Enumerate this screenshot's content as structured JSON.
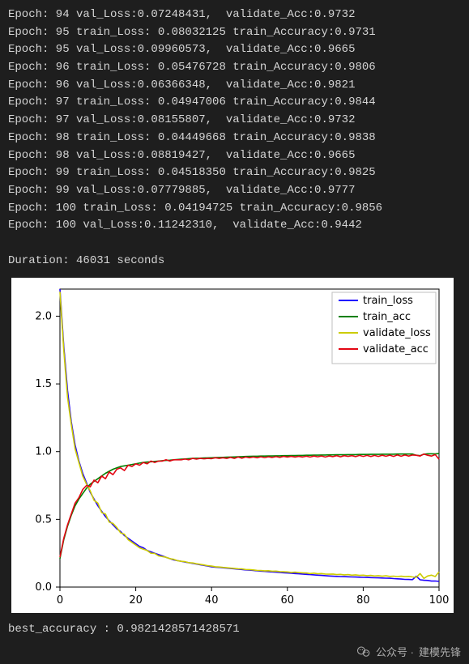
{
  "console_lines": [
    "Epoch: 94 val_Loss:0.07248431,  validate_Acc:0.9732",
    "Epoch: 95 train_Loss: 0.08032125 train_Accuracy:0.9731",
    "Epoch: 95 val_Loss:0.09960573,  validate_Acc:0.9665",
    "Epoch: 96 train_Loss: 0.05476728 train_Accuracy:0.9806",
    "Epoch: 96 val_Loss:0.06366348,  validate_Acc:0.9821",
    "Epoch: 97 train_Loss: 0.04947006 train_Accuracy:0.9844",
    "Epoch: 97 val_Loss:0.08155807,  validate_Acc:0.9732",
    "Epoch: 98 train_Loss: 0.04449668 train_Accuracy:0.9838",
    "Epoch: 98 val_Loss:0.08819427,  validate_Acc:0.9665",
    "Epoch: 99 train_Loss: 0.04518350 train_Accuracy:0.9825",
    "Epoch: 99 val_Loss:0.07779885,  validate_Acc:0.9777",
    "Epoch: 100 train_Loss: 0.04194725 train_Accuracy:0.9856",
    "Epoch: 100 val_Loss:0.11242310,  validate_Acc:0.9442",
    "",
    "Duration: 46031 seconds"
  ],
  "bottom_line": "best_accuracy : 0.9821428571428571",
  "watermark": {
    "prefix": "公众号 · ",
    "name": "建模先锋"
  },
  "chart_data": {
    "type": "line",
    "xlim": [
      0,
      100
    ],
    "ylim": [
      0.0,
      2.2
    ],
    "xticks": [
      0,
      20,
      40,
      60,
      80,
      100
    ],
    "yticks": [
      0.0,
      0.5,
      1.0,
      1.5,
      2.0
    ],
    "legend": [
      "train_loss",
      "train_acc",
      "validate_loss",
      "validate_acc"
    ],
    "legend_colors": {
      "train_loss": "#1f00ff",
      "train_acc": "#008000",
      "validate_loss": "#cccc00",
      "validate_acc": "#e30613"
    },
    "x": [
      0,
      1,
      2,
      3,
      4,
      5,
      6,
      7,
      8,
      9,
      10,
      11,
      12,
      13,
      14,
      15,
      16,
      17,
      18,
      19,
      20,
      21,
      22,
      23,
      24,
      25,
      26,
      27,
      28,
      29,
      30,
      31,
      32,
      33,
      34,
      35,
      36,
      37,
      38,
      39,
      40,
      41,
      42,
      43,
      44,
      45,
      46,
      47,
      48,
      49,
      50,
      51,
      52,
      53,
      54,
      55,
      56,
      57,
      58,
      59,
      60,
      61,
      62,
      63,
      64,
      65,
      66,
      67,
      68,
      69,
      70,
      71,
      72,
      73,
      74,
      75,
      76,
      77,
      78,
      79,
      80,
      81,
      82,
      83,
      84,
      85,
      86,
      87,
      88,
      89,
      90,
      91,
      92,
      93,
      94,
      95,
      96,
      97,
      98,
      99,
      100
    ],
    "series": [
      {
        "name": "train_loss",
        "color": "#1f00ff",
        "values": [
          2.2,
          1.78,
          1.45,
          1.22,
          1.05,
          0.93,
          0.84,
          0.77,
          0.7,
          0.65,
          0.6,
          0.56,
          0.52,
          0.49,
          0.46,
          0.43,
          0.41,
          0.38,
          0.36,
          0.34,
          0.32,
          0.3,
          0.29,
          0.27,
          0.26,
          0.25,
          0.24,
          0.23,
          0.22,
          0.21,
          0.2,
          0.195,
          0.19,
          0.185,
          0.18,
          0.175,
          0.17,
          0.165,
          0.16,
          0.155,
          0.15,
          0.147,
          0.145,
          0.142,
          0.14,
          0.137,
          0.135,
          0.132,
          0.13,
          0.127,
          0.125,
          0.123,
          0.12,
          0.118,
          0.116,
          0.114,
          0.112,
          0.11,
          0.108,
          0.106,
          0.104,
          0.102,
          0.1,
          0.098,
          0.096,
          0.094,
          0.092,
          0.09,
          0.088,
          0.086,
          0.084,
          0.082,
          0.08,
          0.079,
          0.078,
          0.077,
          0.076,
          0.075,
          0.074,
          0.073,
          0.072,
          0.071,
          0.07,
          0.069,
          0.068,
          0.067,
          0.066,
          0.065,
          0.063,
          0.061,
          0.059,
          0.057,
          0.056,
          0.055,
          0.08,
          0.054,
          0.05,
          0.049,
          0.044,
          0.045,
          0.042
        ]
      },
      {
        "name": "train_acc",
        "color": "#008000",
        "values": [
          0.21,
          0.35,
          0.45,
          0.53,
          0.6,
          0.65,
          0.69,
          0.73,
          0.76,
          0.78,
          0.8,
          0.82,
          0.84,
          0.855,
          0.87,
          0.88,
          0.89,
          0.895,
          0.9,
          0.905,
          0.91,
          0.915,
          0.92,
          0.923,
          0.925,
          0.928,
          0.93,
          0.933,
          0.935,
          0.937,
          0.94,
          0.942,
          0.944,
          0.946,
          0.948,
          0.95,
          0.951,
          0.952,
          0.953,
          0.954,
          0.955,
          0.956,
          0.957,
          0.958,
          0.959,
          0.96,
          0.961,
          0.962,
          0.963,
          0.964,
          0.965,
          0.966,
          0.966,
          0.967,
          0.967,
          0.968,
          0.968,
          0.969,
          0.969,
          0.97,
          0.97,
          0.971,
          0.971,
          0.972,
          0.972,
          0.973,
          0.973,
          0.974,
          0.974,
          0.975,
          0.975,
          0.976,
          0.976,
          0.977,
          0.977,
          0.977,
          0.978,
          0.978,
          0.978,
          0.979,
          0.979,
          0.979,
          0.98,
          0.98,
          0.98,
          0.981,
          0.981,
          0.981,
          0.981,
          0.982,
          0.982,
          0.982,
          0.982,
          0.982,
          0.973,
          0.97,
          0.981,
          0.984,
          0.984,
          0.983,
          0.986
        ]
      },
      {
        "name": "validate_loss",
        "color": "#cccc00",
        "values": [
          2.18,
          1.75,
          1.4,
          1.2,
          1.02,
          0.92,
          0.82,
          0.76,
          0.71,
          0.64,
          0.62,
          0.55,
          0.54,
          0.48,
          0.47,
          0.44,
          0.4,
          0.39,
          0.35,
          0.33,
          0.31,
          0.29,
          0.28,
          0.27,
          0.25,
          0.248,
          0.23,
          0.225,
          0.22,
          0.21,
          0.205,
          0.195,
          0.19,
          0.188,
          0.18,
          0.178,
          0.172,
          0.168,
          0.163,
          0.158,
          0.155,
          0.15,
          0.148,
          0.145,
          0.143,
          0.14,
          0.138,
          0.135,
          0.134,
          0.13,
          0.129,
          0.127,
          0.123,
          0.122,
          0.12,
          0.121,
          0.117,
          0.118,
          0.114,
          0.113,
          0.112,
          0.108,
          0.11,
          0.107,
          0.105,
          0.104,
          0.1,
          0.103,
          0.098,
          0.1,
          0.096,
          0.095,
          0.096,
          0.092,
          0.094,
          0.09,
          0.092,
          0.088,
          0.09,
          0.086,
          0.088,
          0.084,
          0.086,
          0.082,
          0.084,
          0.08,
          0.083,
          0.079,
          0.081,
          0.078,
          0.08,
          0.077,
          0.079,
          0.075,
          0.072,
          0.1,
          0.064,
          0.082,
          0.088,
          0.078,
          0.112
        ]
      },
      {
        "name": "validate_acc",
        "color": "#e30613",
        "values": [
          0.22,
          0.36,
          0.46,
          0.54,
          0.62,
          0.66,
          0.72,
          0.75,
          0.74,
          0.79,
          0.77,
          0.82,
          0.8,
          0.85,
          0.83,
          0.87,
          0.88,
          0.86,
          0.9,
          0.89,
          0.91,
          0.9,
          0.92,
          0.91,
          0.93,
          0.92,
          0.93,
          0.93,
          0.94,
          0.93,
          0.94,
          0.94,
          0.94,
          0.945,
          0.94,
          0.95,
          0.945,
          0.95,
          0.947,
          0.95,
          0.948,
          0.955,
          0.95,
          0.955,
          0.95,
          0.958,
          0.95,
          0.96,
          0.952,
          0.96,
          0.955,
          0.96,
          0.955,
          0.962,
          0.956,
          0.962,
          0.957,
          0.963,
          0.958,
          0.965,
          0.96,
          0.965,
          0.96,
          0.965,
          0.96,
          0.966,
          0.96,
          0.967,
          0.962,
          0.968,
          0.96,
          0.968,
          0.963,
          0.97,
          0.962,
          0.97,
          0.965,
          0.97,
          0.963,
          0.972,
          0.965,
          0.972,
          0.964,
          0.972,
          0.965,
          0.973,
          0.966,
          0.974,
          0.965,
          0.975,
          0.966,
          0.975,
          0.967,
          0.975,
          0.973,
          0.967,
          0.982,
          0.973,
          0.967,
          0.978,
          0.944
        ]
      }
    ]
  }
}
